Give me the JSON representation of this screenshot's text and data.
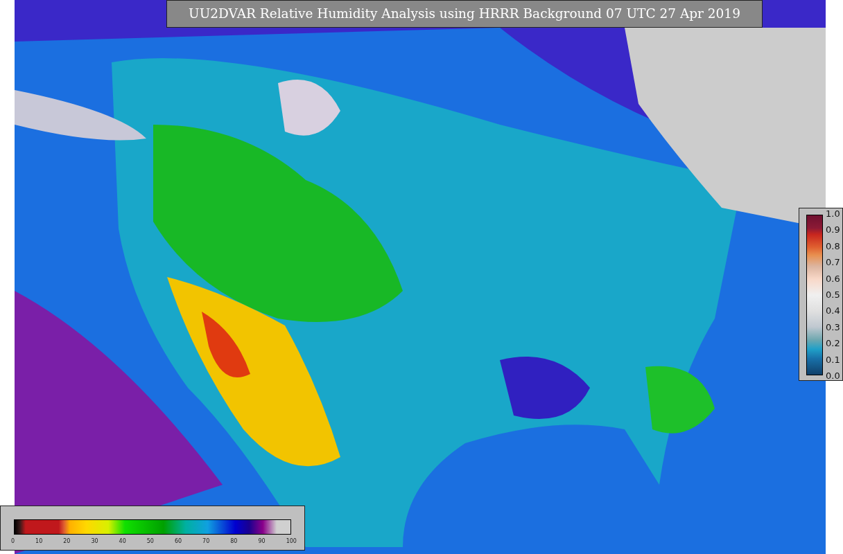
{
  "title": "UU2DVAR Relative Humidity Analysis using HRRR Background 07 UTC 27 Apr 2019",
  "colorbar_right": {
    "ticks": [
      "1.0",
      "0.9",
      "0.8",
      "0.7",
      "0.6",
      "0.5",
      "0.4",
      "0.3",
      "0.2",
      "0.1",
      "0.0"
    ]
  },
  "colorbar_bottom": {
    "ticks": [
      "0",
      "10",
      "20",
      "30",
      "40",
      "50",
      "60",
      "70",
      "80",
      "90",
      "100"
    ]
  }
}
